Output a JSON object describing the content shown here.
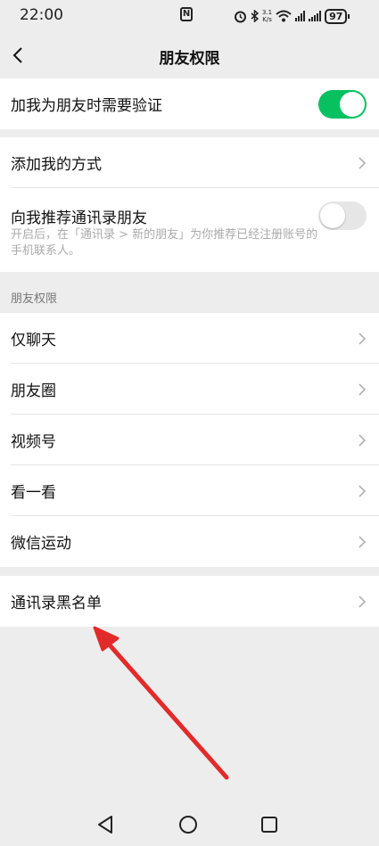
{
  "status_bar": {
    "time": "22:00",
    "nfc": "N",
    "speed_top": "3.1",
    "speed_bottom": "K/s",
    "battery": "97"
  },
  "header": {
    "title": "朋友权限",
    "back_icon": "chevron-left-icon"
  },
  "verify": {
    "label": "加我为朋友时需要验证",
    "toggle_on": true
  },
  "add_methods": {
    "label": "添加我的方式"
  },
  "recommend": {
    "title": "向我推荐通讯录朋友",
    "desc": "开启后，在「通讯录 > 新的朋友」为你推荐已经注册账号的手机联系人。",
    "toggle_on": false
  },
  "friend_permissions": {
    "header": "朋友权限",
    "items": [
      {
        "label": "仅聊天"
      },
      {
        "label": "朋友圈"
      },
      {
        "label": "视频号"
      },
      {
        "label": "看一看"
      },
      {
        "label": "微信运动"
      }
    ]
  },
  "blacklist": {
    "label": "通讯录黑名单"
  },
  "colors": {
    "accent_green": "#07c160",
    "background": "#ededed",
    "annotation_arrow": "#e32a2a"
  },
  "system_nav": {
    "icons": [
      "back-triangle-icon",
      "home-circle-icon",
      "recents-square-icon"
    ]
  }
}
